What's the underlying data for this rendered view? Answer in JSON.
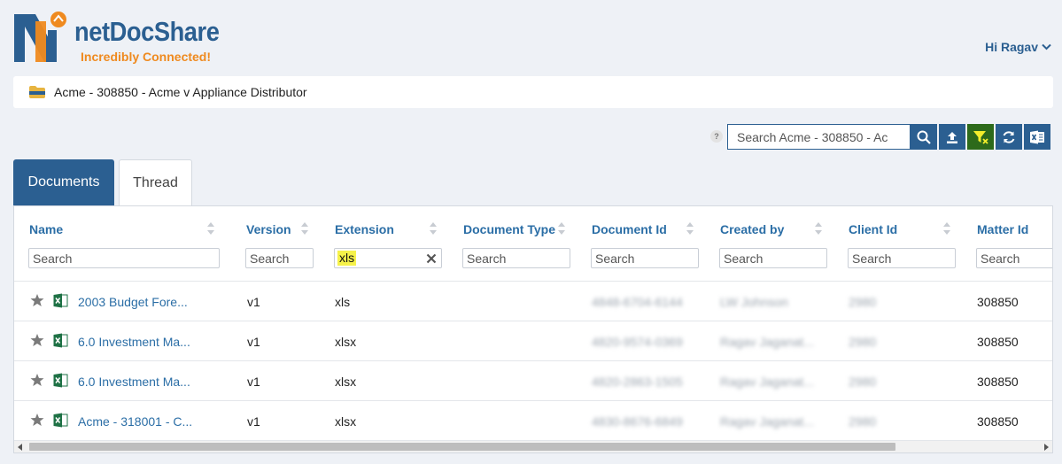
{
  "brand": {
    "name_prefix": "N",
    "name_rest": "netDocShare",
    "tagline": "Incredibly Connected!",
    "primary_color": "#2b5f91",
    "accent_color": "#ef8a1f"
  },
  "user": {
    "greeting": "Hi Ragav"
  },
  "breadcrumb": {
    "icon": "folder-icon",
    "text": "Acme - 308850 - Acme v Appliance Distributor"
  },
  "toolbar": {
    "help_label": "?",
    "search_placeholder": "Search Acme - 308850 - Ac",
    "buttons": [
      {
        "name": "search-button",
        "icon": "search-icon"
      },
      {
        "name": "upload-button",
        "icon": "upload-icon"
      },
      {
        "name": "clear-filter-button",
        "icon": "filter-clear-icon",
        "active": true
      },
      {
        "name": "refresh-button",
        "icon": "refresh-icon"
      },
      {
        "name": "export-excel-button",
        "icon": "excel-icon"
      }
    ]
  },
  "tabs": [
    {
      "label": "Documents",
      "active": true
    },
    {
      "label": "Thread",
      "active": false
    }
  ],
  "table": {
    "columns": [
      {
        "key": "name",
        "label": "Name",
        "filter_placeholder": "Search",
        "filter_value": ""
      },
      {
        "key": "version",
        "label": "Version",
        "filter_placeholder": "Search",
        "filter_value": ""
      },
      {
        "key": "extension",
        "label": "Extension",
        "filter_placeholder": "Search",
        "filter_value": "xls"
      },
      {
        "key": "doc_type",
        "label": "Document Type",
        "filter_placeholder": "Search",
        "filter_value": ""
      },
      {
        "key": "doc_id",
        "label": "Document Id",
        "filter_placeholder": "Search",
        "filter_value": ""
      },
      {
        "key": "created_by",
        "label": "Created by",
        "filter_placeholder": "Search",
        "filter_value": ""
      },
      {
        "key": "client_id",
        "label": "Client Id",
        "filter_placeholder": "Search",
        "filter_value": ""
      },
      {
        "key": "matter_id",
        "label": "Matter Id",
        "filter_placeholder": "Search",
        "filter_value": ""
      }
    ],
    "rows": [
      {
        "name": "2003 Budget Fore...",
        "version": "v1",
        "extension": "xls",
        "doc_type": "",
        "doc_id": "4848-6704-6144",
        "created_by": "LW Johnson",
        "client_id": "2980",
        "matter_id": "308850"
      },
      {
        "name": "6.0 Investment Ma...",
        "version": "v1",
        "extension": "xlsx",
        "doc_type": "",
        "doc_id": "4820-9574-0369",
        "created_by": "Ragav Jaganat...",
        "client_id": "2980",
        "matter_id": "308850"
      },
      {
        "name": "6.0 Investment Ma...",
        "version": "v1",
        "extension": "xlsx",
        "doc_type": "",
        "doc_id": "4820-2863-1505",
        "created_by": "Ragav Jaganat...",
        "client_id": "2980",
        "matter_id": "308850"
      },
      {
        "name": "Acme - 318001 - C...",
        "version": "v1",
        "extension": "xlsx",
        "doc_type": "",
        "doc_id": "4830-8676-6849",
        "created_by": "Ragav Jaganat...",
        "client_id": "2980",
        "matter_id": "308850"
      }
    ]
  }
}
